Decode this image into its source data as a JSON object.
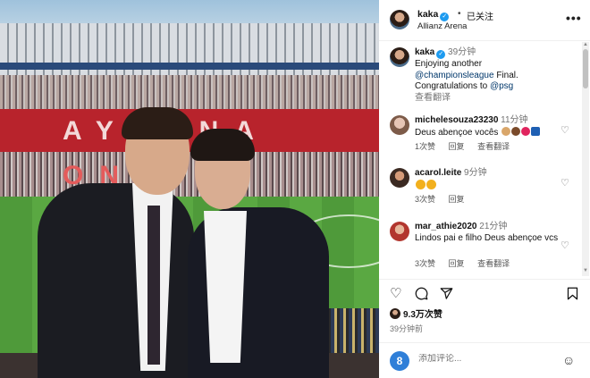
{
  "photo": {
    "banner_top": "AYRENA",
    "banner_bottom": "ONE"
  },
  "header": {
    "username": "kaka",
    "separator": "•",
    "follow_label": "已关注",
    "location": "Allianz Arena",
    "more_icon": "ellipsis-icon"
  },
  "caption": {
    "username": "kaka",
    "time": "39分钟",
    "text_1": "Enjoying another",
    "mention_1": "@championsleague",
    "text_2": " Final.",
    "text_3": "Congratulations to ",
    "mention_2": "@psg",
    "translate": "查看翻译"
  },
  "comments": [
    {
      "username": "michelesouza23230",
      "time": "11分钟",
      "text": "Deus abençoe vocês",
      "likes": "1次赞",
      "reply": "回复",
      "translate": "查看翻译"
    },
    {
      "username": "acarol.leite",
      "time": "9分钟",
      "text": "",
      "likes": "3次赞",
      "reply": "回复"
    },
    {
      "username": "mar_athie2020",
      "time": "21分钟",
      "text": "Lindos pai e filho Deus abençoe vcs",
      "likes": "3次赞",
      "reply": "回复",
      "translate": "查看翻译"
    }
  ],
  "likes_count": "9.3万次赞",
  "posted_time": "39分钟前",
  "compose": {
    "avatar_letter": "8",
    "placeholder": "添加评论..."
  },
  "colors": {
    "verified": "#1d9bf0",
    "mention": "#00376b",
    "secondary_text": "#737373"
  }
}
